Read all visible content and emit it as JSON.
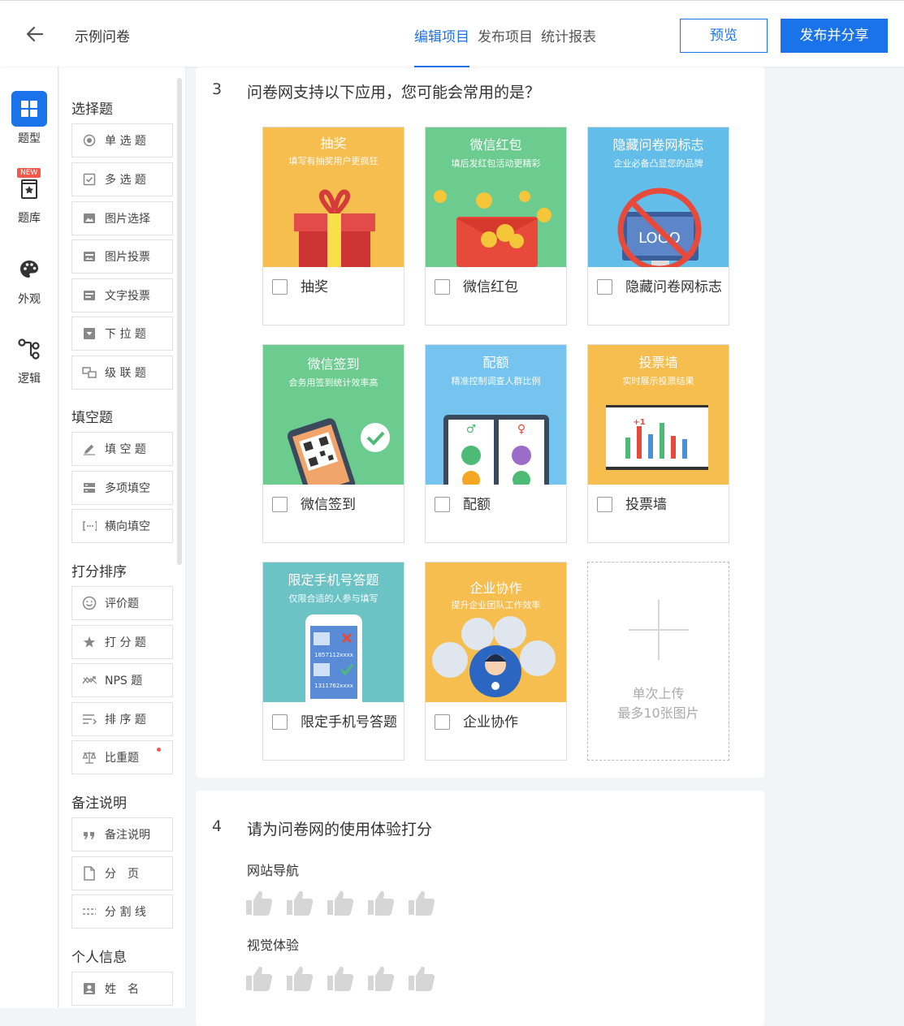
{
  "header": {
    "back_icon": "back-arrow-icon",
    "title": "示例问卷",
    "tabs": [
      {
        "label": "编辑项目",
        "active": true
      },
      {
        "label": "发布项目",
        "active": false
      },
      {
        "label": "统计报表",
        "active": false
      }
    ],
    "preview_label": "预览",
    "publish_label": "发布并分享",
    "accent": "#1a73e8"
  },
  "rail": {
    "items": [
      {
        "label": "题型",
        "icon": "grid-icon",
        "active": true
      },
      {
        "label": "题库",
        "icon": "question-bank-icon",
        "badge": "NEW"
      },
      {
        "label": "外观",
        "icon": "palette-icon"
      },
      {
        "label": "逻辑",
        "icon": "logic-icon"
      }
    ]
  },
  "panel": {
    "groups": [
      {
        "title": "选择题",
        "items": [
          "单 选 题",
          "多 选 题",
          "图片选择",
          "图片投票",
          "文字投票",
          "下 拉 题",
          "级 联 题"
        ]
      },
      {
        "title": "填空题",
        "items": [
          "填 空 题",
          "多项填空",
          "横向填空"
        ]
      },
      {
        "title": "打分排序",
        "items": [
          "评价题",
          "打 分 题",
          "NPS 题",
          "排 序 题",
          "比重题"
        ]
      },
      {
        "title": "备注说明",
        "items": [
          "备注说明",
          "分　页",
          "分 割 线"
        ]
      },
      {
        "title": "个人信息",
        "items": [
          "姓　名"
        ]
      }
    ]
  },
  "q3": {
    "number": "3",
    "text": "问卷网支持以下应用，您可能会常用的是？",
    "options": [
      {
        "title": "抽奖",
        "subtitle": "填写有抽奖用户更疯狂",
        "label": "抽奖",
        "bg": "#f6bd4f"
      },
      {
        "title": "微信红包",
        "subtitle": "填后发红包活动更精彩",
        "label": "微信红包",
        "bg": "#6ccb8f"
      },
      {
        "title": "隐藏问卷网标志",
        "subtitle": "企业必备凸显您的品牌",
        "label": "隐藏问卷网标志",
        "bg": "#62bde8",
        "logo_text": "LOGO"
      },
      {
        "title": "微信签到",
        "subtitle": "会务用签到统计效率高",
        "label": "微信签到",
        "bg": "#6ccb8f"
      },
      {
        "title": "配额",
        "subtitle": "精准控制调查人群比例",
        "label": "配额",
        "bg": "#74c4ef"
      },
      {
        "title": "投票墙",
        "subtitle": "实时展示投票结果",
        "label": "投票墙",
        "bg": "#f6bd4f",
        "plus_text": "+1"
      },
      {
        "title": "限定手机号答题",
        "subtitle": "仅限合适的人参与填写",
        "label": "限定手机号答题",
        "bg": "#6cc3c6",
        "phone1": "1857112xxxx",
        "phone2": "1311762xxxx"
      },
      {
        "title": "企业协作",
        "subtitle": "提升企业团队工作效率",
        "label": "企业协作",
        "bg": "#f6bd4f"
      }
    ],
    "upload_line1": "单次上传",
    "upload_line2": "最多10张图片"
  },
  "q4": {
    "number": "4",
    "text": "请为问卷网的使用体验打分",
    "rows": [
      {
        "title": "网站导航",
        "stars": 5
      },
      {
        "title": "视觉体验",
        "stars": 5
      }
    ],
    "thumb_color": "#d6d6d6"
  }
}
